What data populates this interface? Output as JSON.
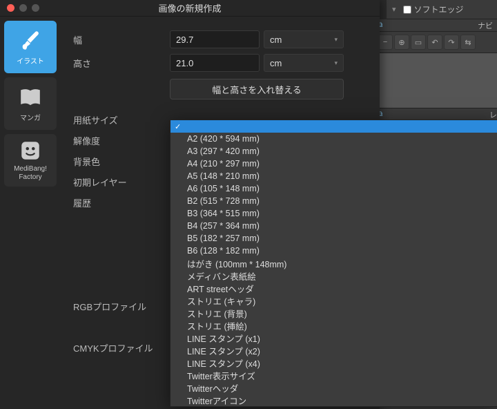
{
  "bg": {
    "soft_edge": "ソフトエッジ",
    "nav_label": "ナビ",
    "layer_label": "レ"
  },
  "dialog": {
    "title": "画像の新規作成"
  },
  "sidebar": {
    "items": [
      {
        "label": "イラスト"
      },
      {
        "label": "マンガ"
      },
      {
        "label": "MediBang!\nFactory"
      }
    ]
  },
  "form": {
    "width_label": "幅",
    "width_value": "29.7",
    "width_unit": "cm",
    "height_label": "高さ",
    "height_value": "21.0",
    "height_unit": "cm",
    "swap_label": "幅と高さを入れ替える",
    "paper_size_label": "用紙サイズ",
    "resolution_label": "解像度",
    "bg_color_label": "背景色",
    "initial_layer_label": "初期レイヤー",
    "history_label": "履歴",
    "rgb_profile_label": "RGBプロファイル",
    "cmyk_profile_label": "CMYKプロファイル"
  },
  "paper_sizes": [
    "",
    "A2 (420 * 594 mm)",
    "A3 (297 * 420 mm)",
    "A4 (210 * 297 mm)",
    "A5 (148 * 210 mm)",
    "A6 (105 * 148 mm)",
    "B2 (515 * 728 mm)",
    "B3 (364 * 515 mm)",
    "B4 (257 * 364 mm)",
    "B5 (182 * 257 mm)",
    "B6 (128 * 182 mm)",
    "はがき (100mm * 148mm)",
    "メディバン表紙絵",
    "ART streetヘッダ",
    "ストリエ (キャラ)",
    "ストリエ (背景)",
    "ストリエ (挿絵)",
    "LINE スタンプ (x1)",
    "LINE スタンプ (x2)",
    "LINE スタンプ (x4)",
    "Twitter表示サイズ",
    "Twitterヘッダ",
    "Twitterアイコン"
  ]
}
